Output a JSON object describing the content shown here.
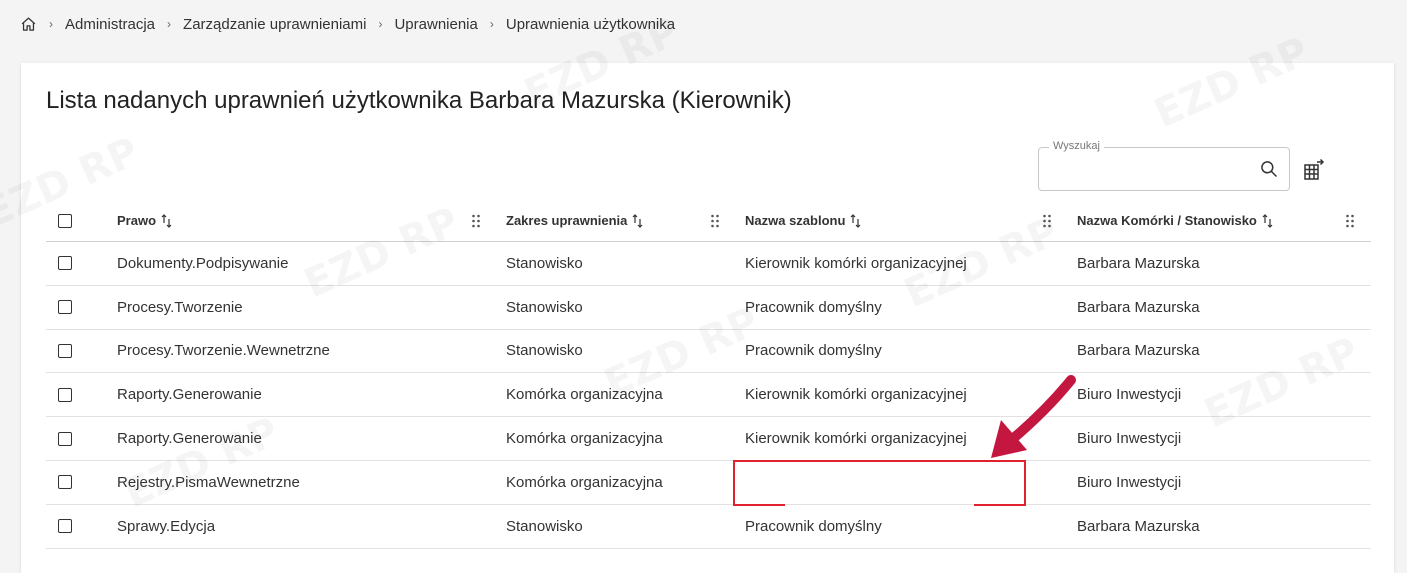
{
  "breadcrumb": {
    "items": [
      "Administracja",
      "Zarządzanie uprawnieniami",
      "Uprawnienia",
      "Uprawnienia użytkownika"
    ]
  },
  "page": {
    "title": "Lista nadanych uprawnień użytkownika Barbara Mazurska (Kierownik)"
  },
  "search": {
    "label": "Wyszukaj",
    "value": ""
  },
  "table": {
    "columns": [
      "Prawo",
      "Zakres uprawnienia",
      "Nazwa szablonu",
      "Nazwa Komórki / Stanowisko"
    ],
    "rows": [
      [
        "Dokumenty.Podpisywanie",
        "Stanowisko",
        "Kierownik komórki organizacyjnej",
        "Barbara Mazurska"
      ],
      [
        "Procesy.Tworzenie",
        "Stanowisko",
        "Pracownik domyślny",
        "Barbara Mazurska"
      ],
      [
        "Procesy.Tworzenie.Wewnetrzne",
        "Stanowisko",
        "Pracownik domyślny",
        "Barbara Mazurska"
      ],
      [
        "Raporty.Generowanie",
        "Komórka organizacyjna",
        "Kierownik komórki organizacyjnej",
        "Biuro Inwestycji"
      ],
      [
        "Raporty.Generowanie",
        "Komórka organizacyjna",
        "Kierownik komórki organizacyjnej",
        "Biuro Inwestycji"
      ],
      [
        "Rejestry.PismaWewnetrzne",
        "Komórka organizacyjna",
        "",
        "Biuro Inwestycji"
      ],
      [
        "Sprawy.Edycja",
        "Stanowisko",
        "Pracownik domyślny",
        "Barbara Mazurska"
      ]
    ]
  },
  "annotation": {
    "color": "#e0212e"
  },
  "icons": {
    "home": "home-icon",
    "search": "search-icon",
    "export": "table-export-icon",
    "sort": "sort-icon",
    "drag": "drag-handle-icon"
  }
}
